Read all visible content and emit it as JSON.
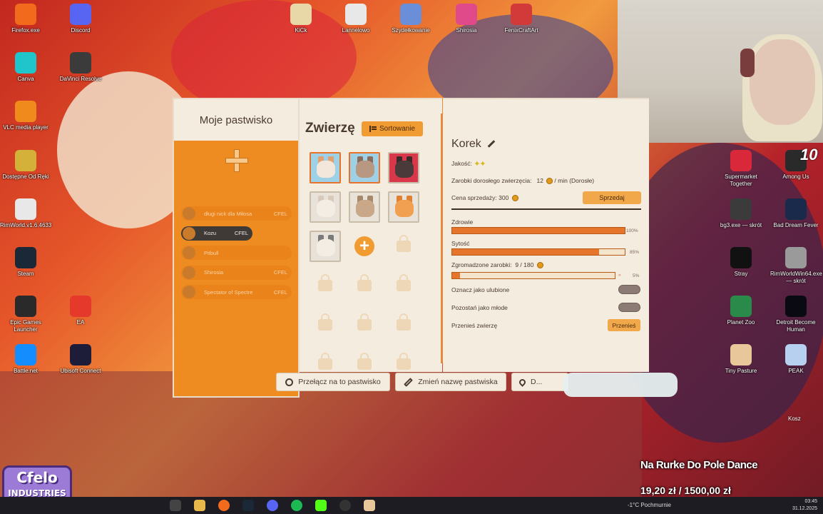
{
  "desktop": {
    "icons_left": [
      {
        "label": "Firefox.exe",
        "icon": "firefox-icon",
        "color": "#f26b1d"
      },
      {
        "label": "Discord",
        "icon": "discord-icon",
        "color": "#5865f2"
      },
      {
        "label": "Canva",
        "icon": "canva-icon",
        "color": "#20c4cb"
      },
      {
        "label": "DaVinci Resolve",
        "icon": "davinci-icon",
        "color": "#3b3b3b"
      },
      {
        "label": "VLC media player",
        "icon": "vlc-icon",
        "color": "#f08a1c"
      },
      {
        "label": "Dostępne Od Ręki",
        "icon": "folder-icon",
        "color": "#d4b23a"
      },
      {
        "label": "RimWorld.v1.6.4633",
        "icon": "file-icon",
        "color": "#e8e8e8"
      },
      {
        "label": "Steam",
        "icon": "steam-icon",
        "color": "#1b2838"
      },
      {
        "label": "Epic Games Launcher",
        "icon": "epic-icon",
        "color": "#2a2a2a"
      },
      {
        "label": "EA",
        "icon": "ea-icon",
        "color": "#e4392b"
      },
      {
        "label": "Battle.net",
        "icon": "battlenet-icon",
        "color": "#148eff"
      },
      {
        "label": "Ubisoft Connect",
        "icon": "ubisoft-icon",
        "color": "#1d1d3a"
      }
    ],
    "icons_top": [
      {
        "label": "KiCk",
        "icon": "kick-icon",
        "color": "#e8d8a8"
      },
      {
        "label": "Lannelowo",
        "icon": "doc-icon",
        "color": "#e8e8e8"
      },
      {
        "label": "Szydełkowanie",
        "icon": "scissors-icon",
        "color": "#6a8fd8"
      },
      {
        "label": "Shirosia",
        "icon": "shirosia-icon",
        "color": "#e04a8a"
      },
      {
        "label": "FenixCraftArt",
        "icon": "fenix-icon",
        "color": "#d23a3a"
      }
    ],
    "icons_right": [
      {
        "label": "Supermarket Together",
        "icon": "supermarket-icon",
        "color": "#d8283a"
      },
      {
        "label": "Among Us",
        "icon": "amongus-icon",
        "color": "#2a2a2a"
      },
      {
        "label": "bg3.exe — skrót",
        "icon": "bg3-icon",
        "color": "#3b3b3b"
      },
      {
        "label": "Bad Dream Fever",
        "icon": "baddream-icon",
        "color": "#1a2a4a"
      },
      {
        "label": "Stray",
        "icon": "stray-icon",
        "color": "#111111"
      },
      {
        "label": "RimWorldWin64.exe — skrót",
        "icon": "rimworld-icon",
        "color": "#9a9a9a"
      },
      {
        "label": "Planet Zoo",
        "icon": "planetzoo-icon",
        "color": "#2a8a4a"
      },
      {
        "label": "Detroit Become Human",
        "icon": "detroit-icon",
        "color": "#0a0a12"
      },
      {
        "label": "Tiny Pasture",
        "icon": "tinypasture-icon",
        "color": "#e8c89a"
      },
      {
        "label": "PEAK",
        "icon": "peak-icon",
        "color": "#b8d0f0"
      }
    ],
    "among_us_badge": "10",
    "kosz_label": "Kosz"
  },
  "game": {
    "pastures_title": "Moje pastwisko",
    "pastures": [
      {
        "name": "długi nick dla Miłosa",
        "tag": "CFEL",
        "active": false
      },
      {
        "name": "Kozu",
        "tag": "CFEL",
        "active": true
      },
      {
        "name": "Pitbull",
        "tag": "",
        "active": false
      },
      {
        "name": "Shirosia",
        "tag": "CFEL",
        "active": false
      },
      {
        "name": "Spectator of Spectre",
        "tag": "CFEL",
        "active": false
      }
    ],
    "animals_title": "Zwierzę",
    "sort_label": "Sortowanie",
    "add_symbol": "+",
    "animal_name": "Korek",
    "quality_label": "Jakość:",
    "quality_stars": "✦✦",
    "earnings_label": "Zarobki dorosłego zwierzęcia:",
    "earnings_value": "12",
    "earnings_unit": "/ min",
    "earnings_note": "(Dorosłe)",
    "price_label": "Cena sprzedaży:",
    "price_value": "300",
    "sell_label": "Sprzedaj",
    "health_label": "Zdrowie",
    "health_pct": "100%",
    "health_level": 1.0,
    "satiety_label": "Sytość",
    "satiety_pct": "85%",
    "satiety_level": 0.85,
    "collected_label": "Zgromadzone zarobki:",
    "collected_value": "9 / 180",
    "collected_pct": "5%",
    "collected_level": 0.05,
    "favorite_label": "Oznacz jako ulubione",
    "young_label": "Pozostań jako młode",
    "move_label": "Przenieś zwierzę",
    "move_button": "Przenieś",
    "switch_button": "Przełącz na to pastwisko",
    "rename_button": "Zmień nazwę pastwiska",
    "third_button": "D..."
  },
  "stream": {
    "logo_line1": "Cfelo",
    "logo_line2": "INDUSTRIES",
    "goal_title": "Na Rurke Do Pole Dance",
    "goal_progress": "19,20 zł / 1500,00 zł"
  },
  "taskbar": {
    "weather": "-1°C  Pochmurnie",
    "time": "03:45",
    "date": "31.12.2025"
  }
}
